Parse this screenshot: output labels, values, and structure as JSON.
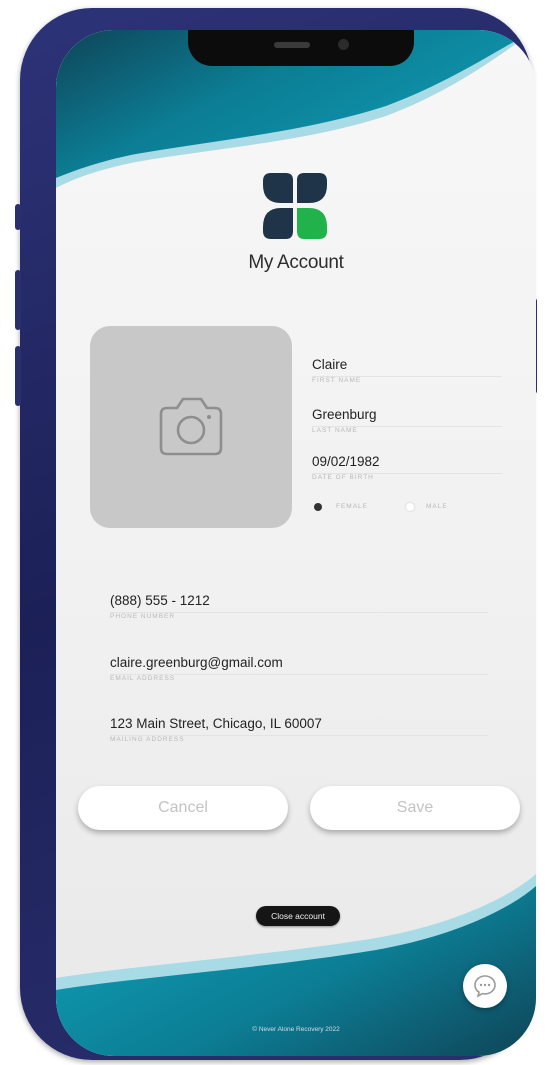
{
  "screen": {
    "title": "My Account",
    "copyright": "© Never Alone Recovery 2022"
  },
  "profile": {
    "photo_icon": "camera-icon",
    "first_name": {
      "value": "Claire",
      "label": "FIRST NAME"
    },
    "last_name": {
      "value": "Greenburg",
      "label": "LAST NAME"
    },
    "dob": {
      "value": "09/02/1982",
      "label": "DATE OF BIRTH"
    },
    "gender": {
      "female_label": "FEMALE",
      "male_label": "MALE",
      "selected": "FEMALE"
    }
  },
  "contact": {
    "phone": {
      "value": "(888) 555 - 1212",
      "label": "PHONE NUMBER"
    },
    "email": {
      "value": "claire.greenburg@gmail.com",
      "label": "EMAIL ADDRESS"
    },
    "address": {
      "value": "123 Main Street, Chicago, IL 60007",
      "label": "MAILING ADDRESS"
    }
  },
  "actions": {
    "cancel_label": "Cancel",
    "save_label": "Save",
    "close_account_label": "Close account"
  },
  "chat": {
    "icon": "chat-bubble-icon"
  },
  "colors": {
    "teal": "#0c8aa0",
    "navy": "#12475e",
    "light_teal": "#9ad4e0",
    "logo_dark": "#1f3448",
    "logo_green": "#21b24b",
    "frame": "#1e2358"
  }
}
